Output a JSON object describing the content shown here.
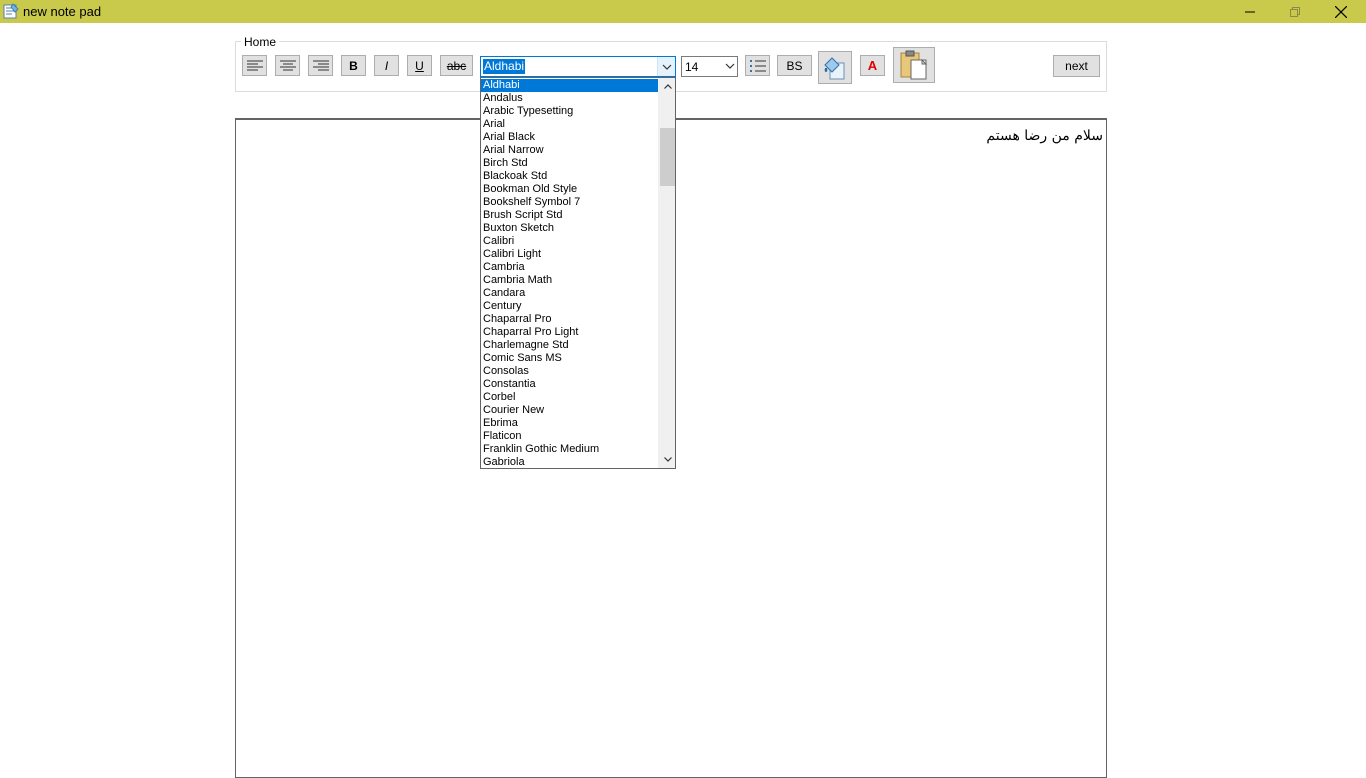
{
  "window": {
    "title": "new note pad"
  },
  "toolbar": {
    "group_label": "Home",
    "bold_label": "B",
    "italic_label": "I",
    "underline_label": "U",
    "strike_label": "abc",
    "bs_label": "BS",
    "color_label": "A",
    "next_label": "next",
    "font_value": "Aldhabi",
    "size_value": "14"
  },
  "font_list": {
    "selected": "Aldhabi",
    "items": [
      "Aldhabi",
      "Andalus",
      "Arabic Typesetting",
      "Arial",
      "Arial Black",
      "Arial Narrow",
      "Birch Std",
      "Blackoak Std",
      "Bookman Old Style",
      "Bookshelf Symbol 7",
      "Brush Script Std",
      "Buxton Sketch",
      "Calibri",
      "Calibri Light",
      "Cambria",
      "Cambria Math",
      "Candara",
      "Century",
      "Chaparral Pro",
      "Chaparral Pro Light",
      "Charlemagne Std",
      "Comic Sans MS",
      "Consolas",
      "Constantia",
      "Corbel",
      "Courier New",
      "Ebrima",
      "Flaticon",
      "Franklin Gothic Medium",
      "Gabriola"
    ]
  },
  "editor": {
    "text": "سلام من رضا هستم"
  },
  "colors": {
    "titlebar": "#c9c94b",
    "selection": "#0078d7",
    "font_color_button": "#e00000"
  }
}
